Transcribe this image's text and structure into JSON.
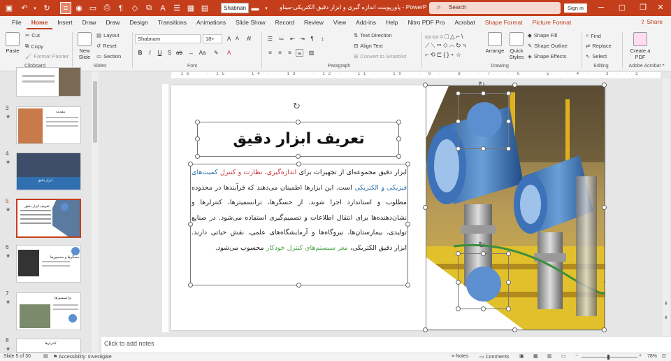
{
  "titlebar": {
    "font_box": "Shabnan",
    "title": "پاورپوینت اندازه گیری و ابزار دقیق الکتریکی-میناو  -  PowerPoint",
    "search_placeholder": "Search",
    "signin": "Sign in",
    "accent": "#c43e1c"
  },
  "tabs": [
    "File",
    "Home",
    "Insert",
    "Draw",
    "Draw",
    "Design",
    "Transitions",
    "Animations",
    "Slide Show",
    "Record",
    "Review",
    "View",
    "Add-ins",
    "Help",
    "Nitro PDF Pro",
    "Acrobat"
  ],
  "context_tabs": [
    "Shape Format",
    "Picture Format"
  ],
  "share": "Share",
  "ribbon": {
    "paste": "Paste",
    "cut": "Cut",
    "copy": "Copy",
    "format_painter": "Format Painter",
    "clipboard": "Clipboard",
    "new_slide": "New Slide",
    "layout": "Layout",
    "reset": "Reset",
    "section": "Section",
    "slides": "Slides",
    "font_name": "Shabnam",
    "font_size": "18+",
    "font": "Font",
    "text_direction": "Text Direction",
    "align_text": "Align Text",
    "convert_smartart": "Convert to SmartArt",
    "paragraph": "Paragraph",
    "arrange": "Arrange",
    "quick_styles": "Quick Styles",
    "shape_fill": "Shape Fill",
    "shape_outline": "Shape Outline",
    "shape_effects": "Shape Effects",
    "drawing": "Drawing",
    "find": "Find",
    "replace": "Replace",
    "select": "Select",
    "editing": "Editing",
    "create_pdf": "Create a PDF",
    "adobe_acrobat": "Adobe Acrobat"
  },
  "thumbnails": [
    {
      "num": "3",
      "star": "★",
      "title": "مقدمه"
    },
    {
      "num": "4",
      "star": "★",
      "title": "ابزار دقیق"
    },
    {
      "num": "5",
      "star": "★",
      "title": "تعریف ابزار دقیق"
    },
    {
      "num": "6",
      "star": "★",
      "title": "حسگرها و سنسورها"
    },
    {
      "num": "7",
      "star": "★",
      "title": "ترانسمیترها"
    },
    {
      "num": "8",
      "star": "★",
      "title": "کنترلرها"
    }
  ],
  "slide": {
    "title": "تعریف ابزار دقیق",
    "body": {
      "p1": "ابزار دقیق مجموعه‌ای از تجهیزات برای ",
      "r1": "اندازه‌گیری، نظارت و کنترل",
      "p2": " ",
      "b1": "کمیت‌های فیزیکی و الکتریکی",
      "p3": " است. این ابزارها اطمینان می‌دهند که فرآیندها در محدوده مطلوب و استاندارد اجرا شوند. از حسگرها، ترانسمیترها، کنترلرها و نشان‌دهنده‌ها برای انتقال اطلاعات و تصمیم‌گیری استفاده می‌شود. در صنایع تولیدی، بیمارستان‌ها، نیروگاه‌ها و آزمایشگاه‌های علمی، نقش حیاتی دارند. ابزار دقیق الکتریکی، ",
      "g1": "مغز سیستم‌های کنترل خودکار",
      "p4": " محسوب می‌شود."
    }
  },
  "notes": "Click to add notes",
  "status": {
    "slide_of": "Slide 5 of 30",
    "accessibility": "Accessibility: Investigate",
    "notes": "Notes",
    "comments": "Comments",
    "zoom": "78%"
  }
}
